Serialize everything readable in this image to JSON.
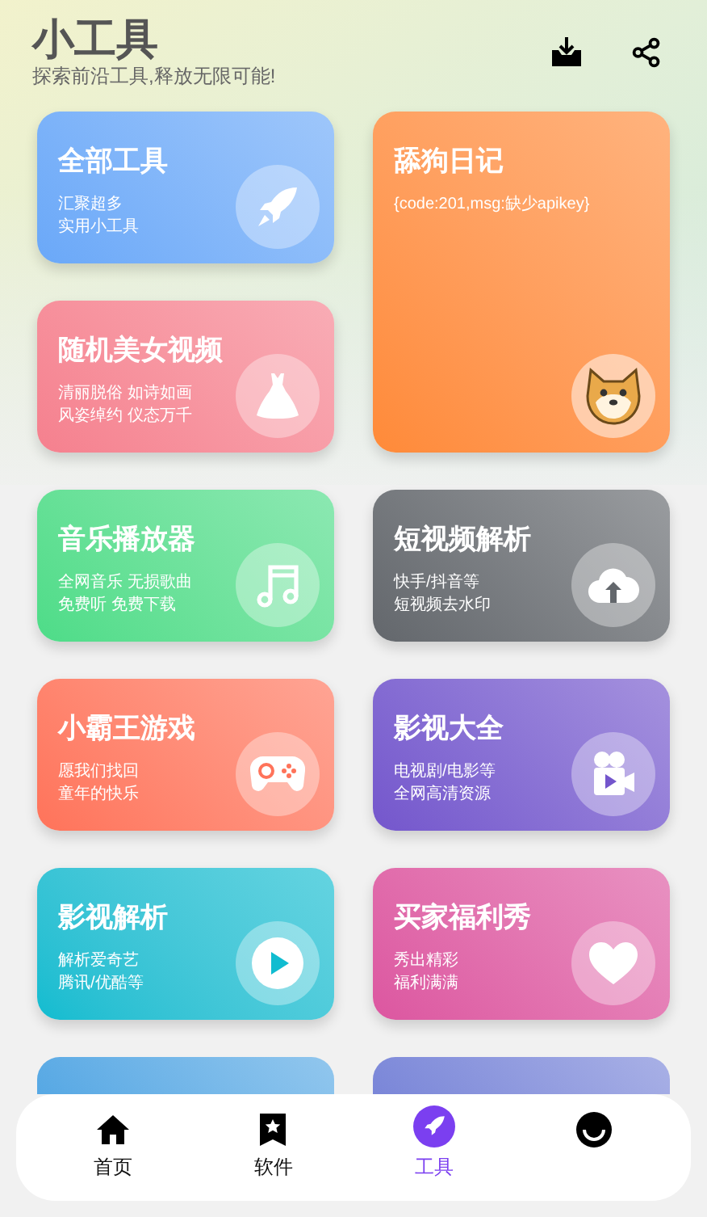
{
  "header": {
    "title": "小工具",
    "subtitle": "探索前沿工具,释放无限可能!"
  },
  "cards": [
    {
      "title": "全部工具",
      "lines": [
        "汇聚超多",
        "实用小工具"
      ],
      "kind": "rocket",
      "tall": false,
      "color": "#6aa8f8"
    },
    {
      "title": "舔狗日记",
      "lines": [
        "{code:201,msg:缺少apikey}"
      ],
      "kind": "dog",
      "tall": true,
      "color": "#ff8a38"
    },
    {
      "title": "随机美女视频",
      "lines": [
        "清丽脱俗 如诗如画",
        "风姿绰约 仪态万千"
      ],
      "kind": "dress",
      "tall": false,
      "color": "#f5808e"
    },
    {
      "title": "音乐播放器",
      "lines": [
        "全网音乐 无损歌曲",
        "免费听 免费下载"
      ],
      "kind": "note",
      "tall": false,
      "color": "#4ddc88"
    },
    {
      "title": "短视频解析",
      "lines": [
        "快手/抖音等",
        "短视频去水印"
      ],
      "kind": "cloud",
      "tall": false,
      "color": "#63676c"
    },
    {
      "title": "小霸王游戏",
      "lines": [
        "愿我们找回",
        "童年的快乐"
      ],
      "kind": "gamepad",
      "tall": false,
      "color": "#ff735a"
    },
    {
      "title": "影视大全",
      "lines": [
        "电视剧/电影等",
        "全网高清资源"
      ],
      "kind": "camera",
      "tall": false,
      "color": "#7456cc"
    },
    {
      "title": "影视解析",
      "lines": [
        "解析爱奇艺",
        "腾讯/优酷等"
      ],
      "kind": "play",
      "tall": false,
      "color": "#10bcd0"
    },
    {
      "title": "买家福利秀",
      "lines": [
        "秀出精彩",
        "福利满满"
      ],
      "kind": "heart",
      "tall": false,
      "color": "#dc56a0"
    },
    {
      "kind": "strip",
      "color": "#56a8e4"
    },
    {
      "kind": "strip",
      "color": "#7a86d8"
    }
  ],
  "nav": [
    {
      "label": "首页",
      "kind": "home",
      "selected": false
    },
    {
      "label": "软件",
      "kind": "bookmark",
      "selected": false
    },
    {
      "label": "工具",
      "kind": "rocket",
      "selected": true
    },
    {
      "kind": "face",
      "selected": false
    }
  ]
}
